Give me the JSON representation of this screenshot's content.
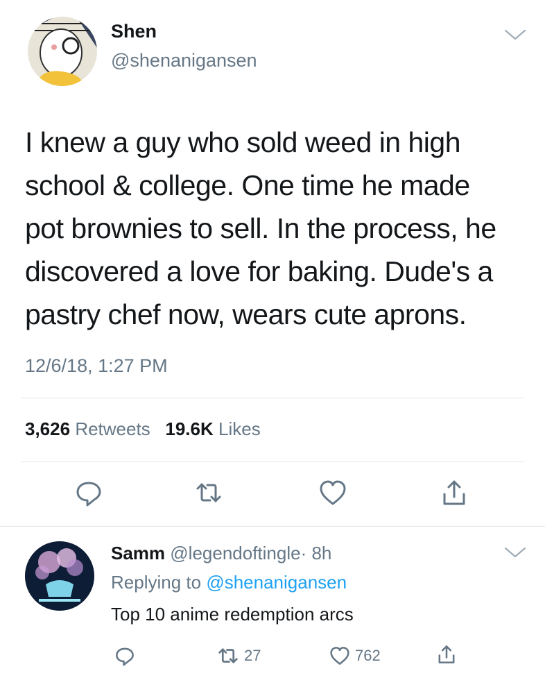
{
  "tweet": {
    "display_name": "Shen",
    "handle": "@shenanigansen",
    "text_lines": [
      "I knew a guy who sold weed in high",
      "school & college. One time he made",
      "pot brownies to sell. In the process, he",
      "discovered a love for baking. Dude's a",
      "pastry chef now, wears cute aprons."
    ],
    "timestamp": "12/6/18, 1:27 PM",
    "retweets_count": "3,626",
    "retweets_label": "Retweets",
    "likes_count": "19.6K",
    "likes_label": "Likes"
  },
  "reply": {
    "display_name": "Samm",
    "handle": "@legendoftingle",
    "age": "· 8h",
    "replying_prefix": "Replying to",
    "replying_to": "@shenanigansen",
    "text": "Top 10 anime redemption arcs",
    "retweet_count": "27",
    "like_count": "762"
  },
  "icons": {
    "more": "chevron-down-icon",
    "reply": "reply-bubble-icon",
    "retweet": "retweet-icon",
    "like": "heart-icon",
    "share": "share-icon"
  },
  "colors": {
    "text": "#14171a",
    "secondary": "#657786",
    "link": "#1da1f2",
    "divider": "#e1e8ed"
  }
}
